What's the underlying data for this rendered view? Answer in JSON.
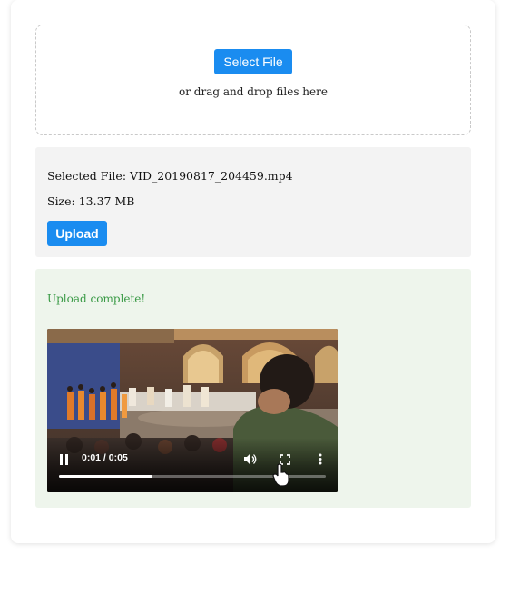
{
  "dropzone": {
    "select_button": "Select File",
    "hint": "or drag and drop files here"
  },
  "file_info": {
    "selected_file": "Selected File: VID_20190817_204459.mp4",
    "size": "Size: 13.37 MB",
    "upload_button": "Upload"
  },
  "result": {
    "status": "Upload complete!",
    "status_color": "#3a9a46"
  },
  "video_player": {
    "time": "0:01 / 0:05",
    "progress": 0.35,
    "state": "playing",
    "icons": [
      "pause-icon",
      "volume-icon",
      "fullscreen-icon",
      "more-options-icon"
    ]
  },
  "colors": {
    "accent": "#1a8cf0",
    "info_bg": "#f3f3f3",
    "result_bg": "#eef5ec"
  }
}
